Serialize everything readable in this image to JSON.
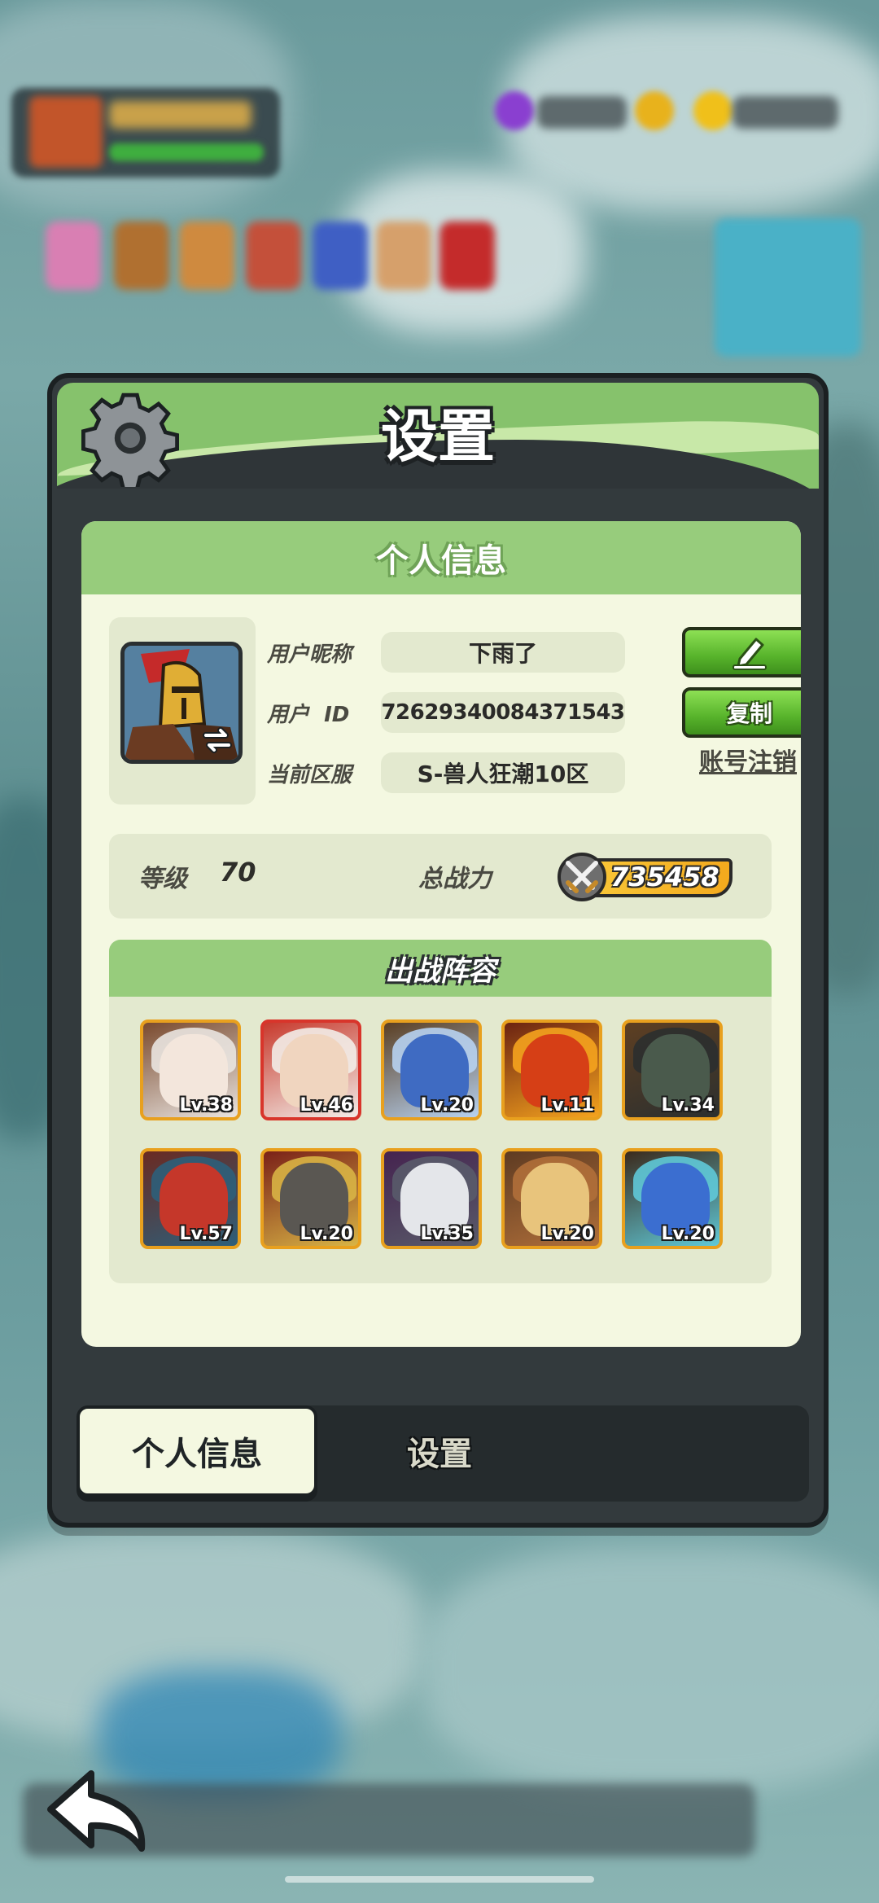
{
  "dialog": {
    "title": "设置"
  },
  "panel": {
    "title": "个人信息"
  },
  "profile": {
    "nickname_label": "用户昵称",
    "nickname": "下雨了",
    "id_label": "用户  ID",
    "user_id": "72629340084371543",
    "server_label": "当前区服",
    "server": "S-兽人狂潮10区",
    "copy_label": "复制",
    "delete_account_label": "账号注销"
  },
  "stats": {
    "level_label": "等级",
    "level": "70",
    "power_label": "总战力",
    "power": "735458"
  },
  "lineup": {
    "title": "出战阵容",
    "heroes": [
      {
        "level": "Lv.38",
        "frame": "gold",
        "colors": [
          "#f3e6dc",
          "#e9e4e0",
          "#7a4a2e"
        ]
      },
      {
        "level": "Lv.46",
        "frame": "red",
        "colors": [
          "#f0d5bf",
          "#f2ede8",
          "#c83a2d"
        ]
      },
      {
        "level": "Lv.20",
        "frame": "gold",
        "colors": [
          "#3f6bc2",
          "#b7d2f1",
          "#5b3f23"
        ]
      },
      {
        "level": "Lv.11",
        "frame": "gold",
        "colors": [
          "#d63f16",
          "#f5a31e",
          "#6b2312"
        ]
      },
      {
        "level": "Lv.34",
        "frame": "gold",
        "colors": [
          "#4a5a4c",
          "#2b2f2f",
          "#5e3f22"
        ]
      },
      {
        "level": "Lv.57",
        "frame": "gold",
        "colors": [
          "#c5372a",
          "#2d5f7a",
          "#6a2a22"
        ]
      },
      {
        "level": "Lv.20",
        "frame": "gold",
        "colors": [
          "#5a5752",
          "#d8b445",
          "#7a2018"
        ]
      },
      {
        "level": "Lv.35",
        "frame": "gold",
        "colors": [
          "#e4e6ea",
          "#595b6a",
          "#45234f"
        ]
      },
      {
        "level": "Lv.20",
        "frame": "gold",
        "colors": [
          "#e8c47c",
          "#b06f3a",
          "#5e3b22"
        ]
      },
      {
        "level": "Lv.20",
        "frame": "gold",
        "colors": [
          "#3b6ed0",
          "#5fc9d8",
          "#3b2a1c"
        ]
      }
    ]
  },
  "tabs": {
    "personal_info": "个人信息",
    "settings": "设置"
  },
  "icons": {
    "gear": "gear-icon",
    "edit": "edit-icon",
    "swap": "swap-icon",
    "power": "sword-icon",
    "back": "back-arrow-icon"
  }
}
